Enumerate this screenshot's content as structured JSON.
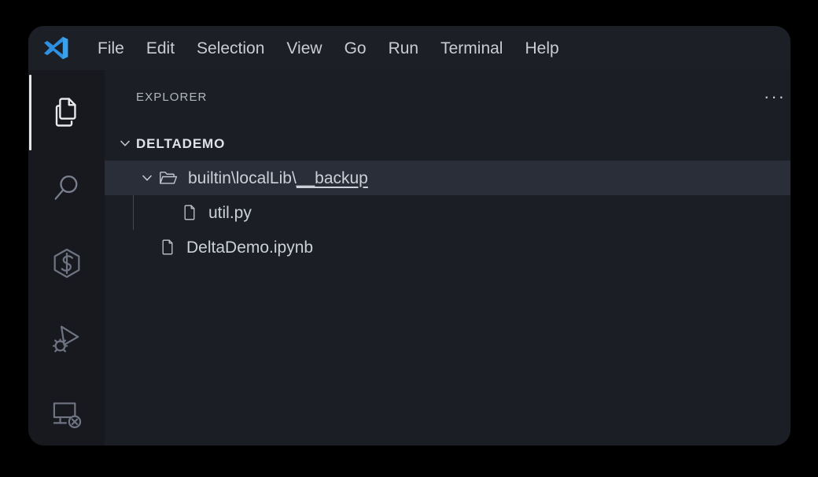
{
  "window": {
    "title_bar": {
      "logo_icon": "vscode-logo-icon",
      "menus": [
        {
          "label": "File"
        },
        {
          "label": "Edit"
        },
        {
          "label": "Selection"
        },
        {
          "label": "View"
        },
        {
          "label": "Go"
        },
        {
          "label": "Run"
        },
        {
          "label": "Terminal"
        },
        {
          "label": "Help"
        }
      ]
    }
  },
  "activity_bar": {
    "items": [
      {
        "name": "explorer",
        "icon": "files-icon",
        "active": true
      },
      {
        "name": "search",
        "icon": "search-icon",
        "active": false
      },
      {
        "name": "source-control",
        "icon": "source-control-icon",
        "active": false
      },
      {
        "name": "run-and-debug",
        "icon": "run-and-debug-icon",
        "active": false
      },
      {
        "name": "remote-explorer",
        "icon": "remote-explorer-icon",
        "active": false
      }
    ]
  },
  "sidebar": {
    "title": "EXPLORER",
    "more_actions_label": "···",
    "tree": {
      "root": {
        "label": "DELTADEMO",
        "expanded": true,
        "chevron_icon": "chevron-down-icon"
      },
      "items": [
        {
          "type": "folder",
          "label": "builtin \\ localLib \\ __backup",
          "label_plain": "builtin",
          "label_sep1": "\\",
          "label_mid": "localLib",
          "label_sep2": "\\",
          "label_tail": "__backup",
          "expanded": true,
          "selected": true,
          "icon": "folder-open-icon",
          "chevron_icon": "chevron-down-icon",
          "depth": 1
        },
        {
          "type": "file",
          "label": "util.py",
          "selected": false,
          "icon": "file-icon",
          "depth": 2
        },
        {
          "type": "file",
          "label": "DeltaDemo.ipynb",
          "selected": false,
          "icon": "file-icon",
          "depth": 1
        }
      ]
    }
  },
  "colors": {
    "page_background": "#000000",
    "window_background": "#1b1e24",
    "title_bar": "#1c1f26",
    "activity_bar": "#17191e",
    "selected_row": "#2a2e38",
    "text_primary": "#ccd0d8",
    "text_muted": "#b3b7c0",
    "accent_logo": "#2f8fe0",
    "active_indicator": "#e6e6e6"
  }
}
